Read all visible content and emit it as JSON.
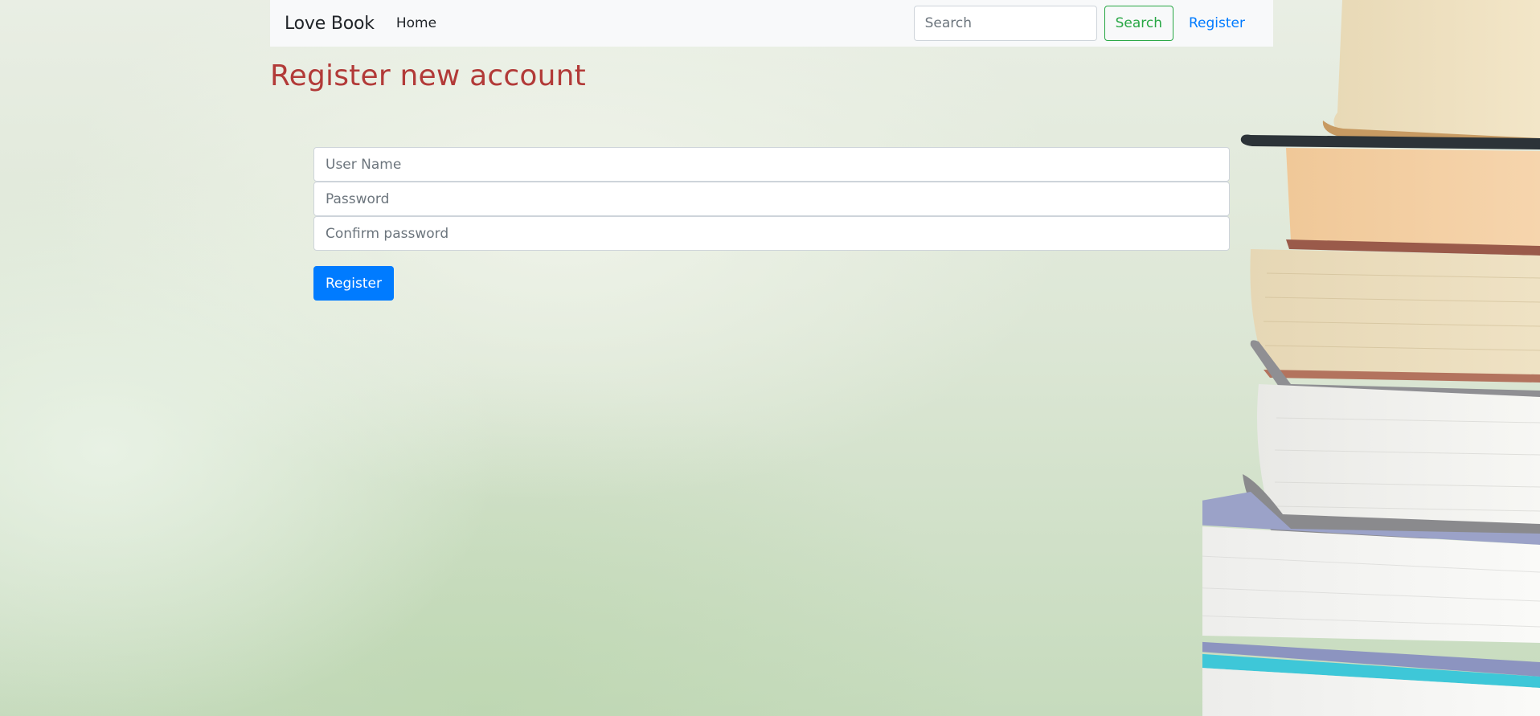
{
  "navbar": {
    "brand": "Love Book",
    "home_label": "Home",
    "search_placeholder": "Search",
    "search_button_label": "Search",
    "register_link_label": "Register"
  },
  "page": {
    "title": "Register new account"
  },
  "form": {
    "username_placeholder": "User Name",
    "password_placeholder": "Password",
    "confirm_password_placeholder": "Confirm password",
    "submit_label": "Register"
  },
  "colors": {
    "title": "#b23a38",
    "primary": "#007bff",
    "success": "#28a745",
    "navbar_bg": "#f8f9fa"
  },
  "icons": {
    "background": "book-stack-image"
  }
}
